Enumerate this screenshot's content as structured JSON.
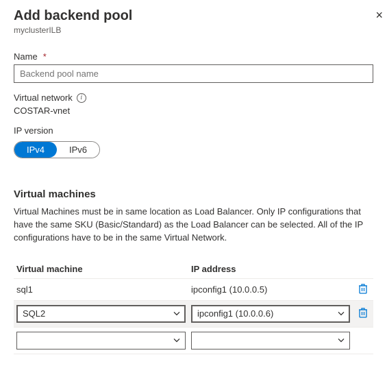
{
  "header": {
    "title": "Add backend pool",
    "subtitle": "myclusterILB",
    "close_glyph": "×"
  },
  "name": {
    "label": "Name",
    "placeholder": "Backend pool name",
    "value": ""
  },
  "vnet": {
    "label": "Virtual network",
    "value": "COSTAR-vnet"
  },
  "ipversion": {
    "label": "IP version",
    "options": [
      "IPv4",
      "IPv6"
    ],
    "selected": "IPv4"
  },
  "vms": {
    "heading": "Virtual machines",
    "help": "Virtual Machines must be in same location as Load Balancer. Only IP configurations that have the same SKU (Basic/Standard) as the Load Balancer can be selected. All of the IP configurations have to be in the same Virtual Network.",
    "columns": {
      "vm": "Virtual machine",
      "ip": "IP address"
    },
    "rows": [
      {
        "vm": "sql1",
        "ip": "ipconfig1 (10.0.0.5)",
        "editable": false,
        "deletable": true
      },
      {
        "vm": "SQL2",
        "ip": "ipconfig1 (10.0.0.6)",
        "editable": true,
        "deletable": true,
        "active": true
      },
      {
        "vm": "",
        "ip": "",
        "editable": true,
        "deletable": false
      }
    ]
  }
}
